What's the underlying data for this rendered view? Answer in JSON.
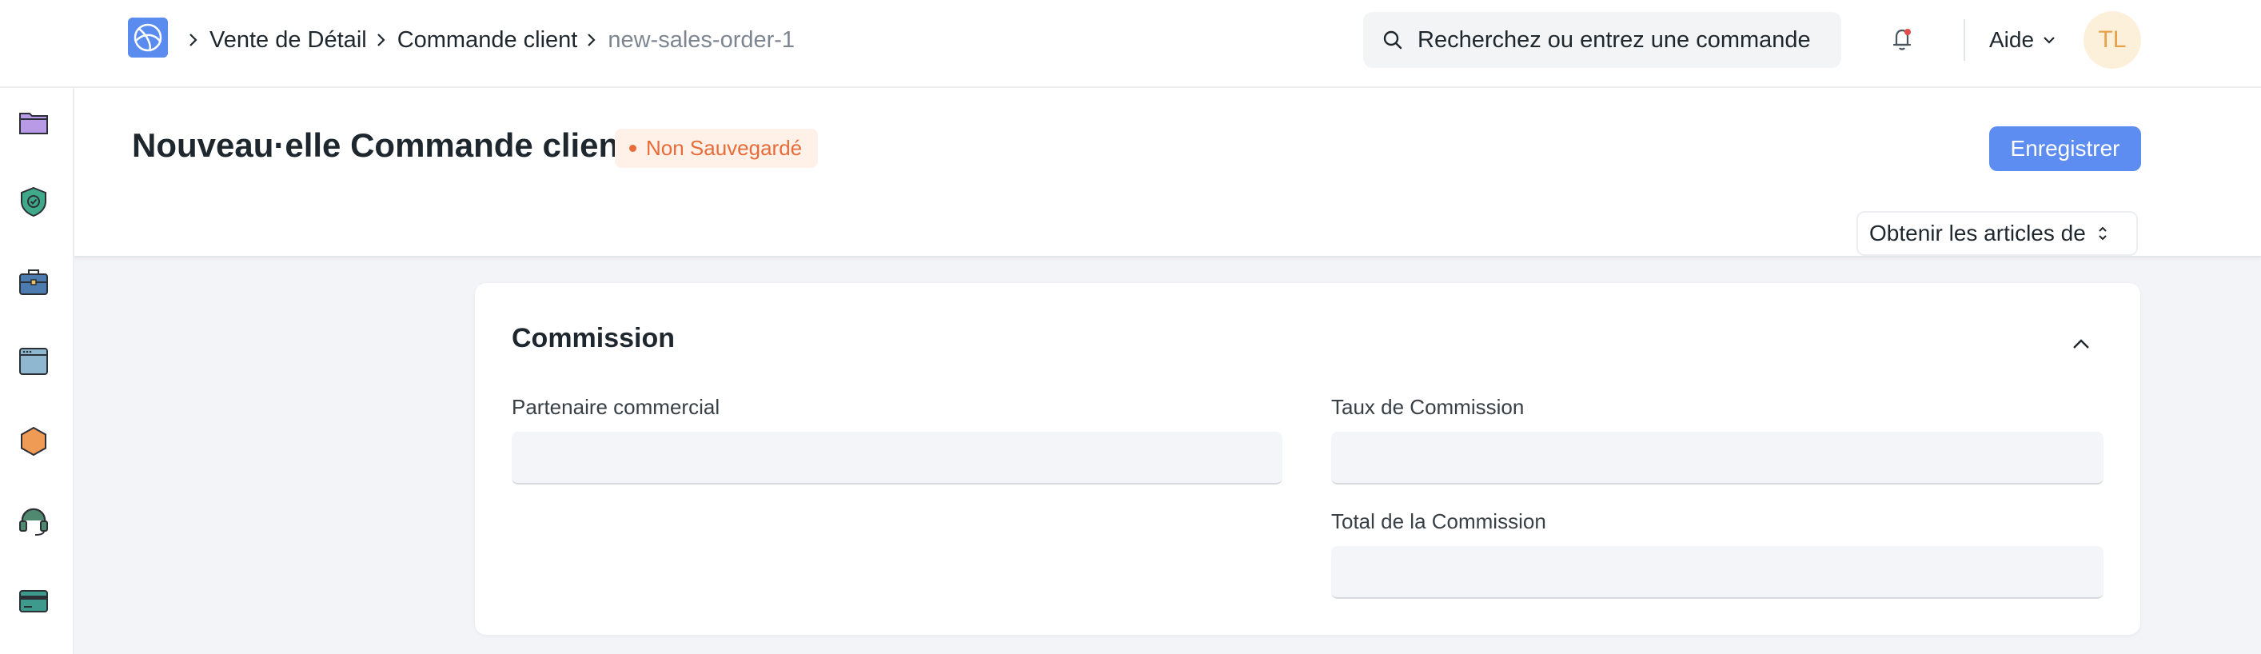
{
  "navbar": {
    "breadcrumbs": [
      "Vente de Détail",
      "Commande client",
      "new-sales-order-1"
    ],
    "search": {
      "placeholder": "Recherchez ou entrez une commande"
    },
    "help_label": "Aide",
    "avatar_initials": "TL"
  },
  "sidebar": {
    "items": [
      {
        "icon": "folder-icon",
        "color": "#b99ae6"
      },
      {
        "icon": "shield-check-icon",
        "color": "#3fa98a"
      },
      {
        "icon": "briefcase-icon",
        "color": "#4c7bb0"
      },
      {
        "icon": "browser-window-icon",
        "color": "#8fb8d0"
      },
      {
        "icon": "hexagon-icon",
        "color": "#ef9a55"
      },
      {
        "icon": "headset-icon",
        "color": "#4f8a70"
      },
      {
        "icon": "credit-card-icon",
        "color": "#3f9a8e"
      }
    ]
  },
  "page": {
    "title": "Nouveau·elle Commande client",
    "status_badge": "Non Sauvegardé",
    "save_label": "Enregistrer",
    "get_items_label": "Obtenir les articles de"
  },
  "section": {
    "title": "Commission",
    "fields": {
      "sales_partner": {
        "label": "Partenaire commercial",
        "value": ""
      },
      "commission_rate": {
        "label": "Taux de Commission",
        "value": ""
      },
      "total_commission": {
        "label": "Total de la Commission",
        "value": ""
      }
    }
  },
  "colors": {
    "primary": "#5e8df2",
    "badge_text": "#e86c3a",
    "badge_bg": "#fff1e7",
    "avatar_bg": "#fdf0db",
    "avatar_text": "#e6a24a"
  }
}
